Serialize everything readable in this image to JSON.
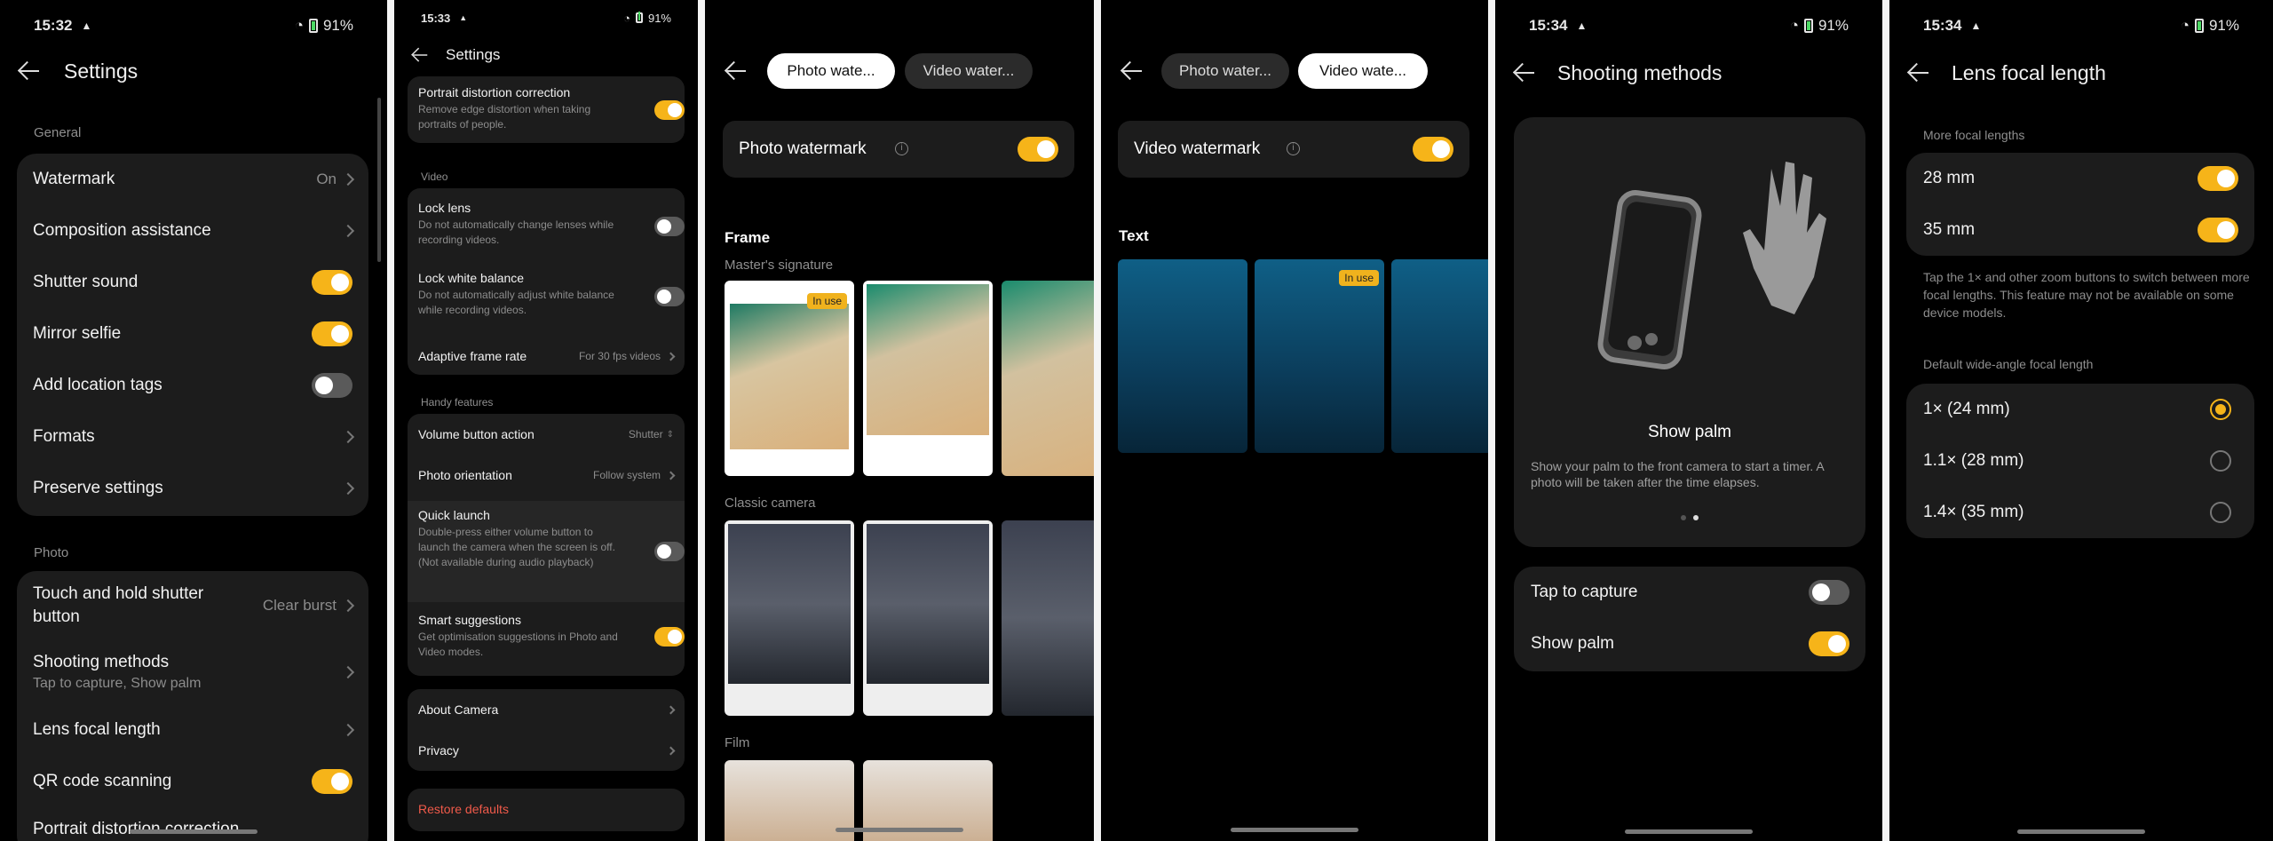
{
  "panel1": {
    "status": {
      "time": "15:32",
      "battery": "91%"
    },
    "title": "Settings",
    "general_label": "General",
    "general": [
      {
        "label": "Watermark",
        "value": "On"
      },
      {
        "label": "Composition assistance"
      },
      {
        "label": "Shutter sound",
        "toggle": true
      },
      {
        "label": "Mirror selfie",
        "toggle": true
      },
      {
        "label": "Add location tags",
        "toggle": false
      },
      {
        "label": "Formats"
      },
      {
        "label": "Preserve settings"
      }
    ],
    "photo_label": "Photo",
    "photo": [
      {
        "label": "Touch and hold shutter button",
        "value": "Clear burst"
      },
      {
        "label": "Shooting methods",
        "sub": "Tap to capture, Show palm"
      },
      {
        "label": "Lens focal length"
      },
      {
        "label": "QR code scanning",
        "toggle": true
      },
      {
        "label": "Portrait distortion correction"
      }
    ]
  },
  "panel2": {
    "status": {
      "time": "15:33",
      "battery": "91%"
    },
    "title": "Settings",
    "portrait": {
      "label": "Portrait distortion correction",
      "sub": "Remove edge distortion when taking portraits of people."
    },
    "video_label": "Video",
    "video": [
      {
        "label": "Lock lens",
        "sub": "Do not automatically change lenses while recording videos."
      },
      {
        "label": "Lock white balance",
        "sub": "Do not automatically adjust white balance while recording videos."
      },
      {
        "label": "Adaptive frame rate",
        "value": "For 30 fps videos"
      }
    ],
    "handy_label": "Handy features",
    "handy": [
      {
        "label": "Volume button action",
        "value": "Shutter"
      },
      {
        "label": "Photo orientation",
        "value": "Follow system"
      },
      {
        "label": "Quick launch",
        "sub": "Double-press either volume button to launch the camera when the screen is off. (Not available during audio playback)"
      },
      {
        "label": "Smart suggestions",
        "sub": "Get optimisation suggestions in Photo and Video modes."
      }
    ],
    "about": "About Camera",
    "privacy": "Privacy",
    "restore": "Restore defaults"
  },
  "panel3": {
    "tab1": "Photo wate...",
    "tab2": "Video water...",
    "toggle_label": "Photo watermark",
    "frame_label": "Frame",
    "masters_label": "Master's signature",
    "in_use": "In use",
    "classic_label": "Classic camera",
    "film_label": "Film"
  },
  "panel4": {
    "tab1": "Photo water...",
    "tab2": "Video wate...",
    "toggle_label": "Video watermark",
    "text_label": "Text",
    "in_use": "In use"
  },
  "panel5": {
    "status": {
      "time": "15:34",
      "battery": "91%"
    },
    "title": "Shooting methods",
    "show_palm_title": "Show palm",
    "show_palm_desc": "Show your palm to the front camera to start a timer. A photo will be taken after the time elapses.",
    "tap_to_capture": "Tap to capture",
    "show_palm": "Show palm"
  },
  "panel6": {
    "status": {
      "time": "15:34",
      "battery": "91%"
    },
    "title": "Lens focal length",
    "more_label": "More focal lengths",
    "mm28": "28 mm",
    "mm35": "35 mm",
    "note": "Tap the 1× and other zoom buttons to switch between more focal lengths. This feature may not be available on some device models.",
    "default_label": "Default wide-angle focal length",
    "options": [
      "1×  (24 mm)",
      "1.1×  (28 mm)",
      "1.4×  (35 mm)"
    ]
  }
}
